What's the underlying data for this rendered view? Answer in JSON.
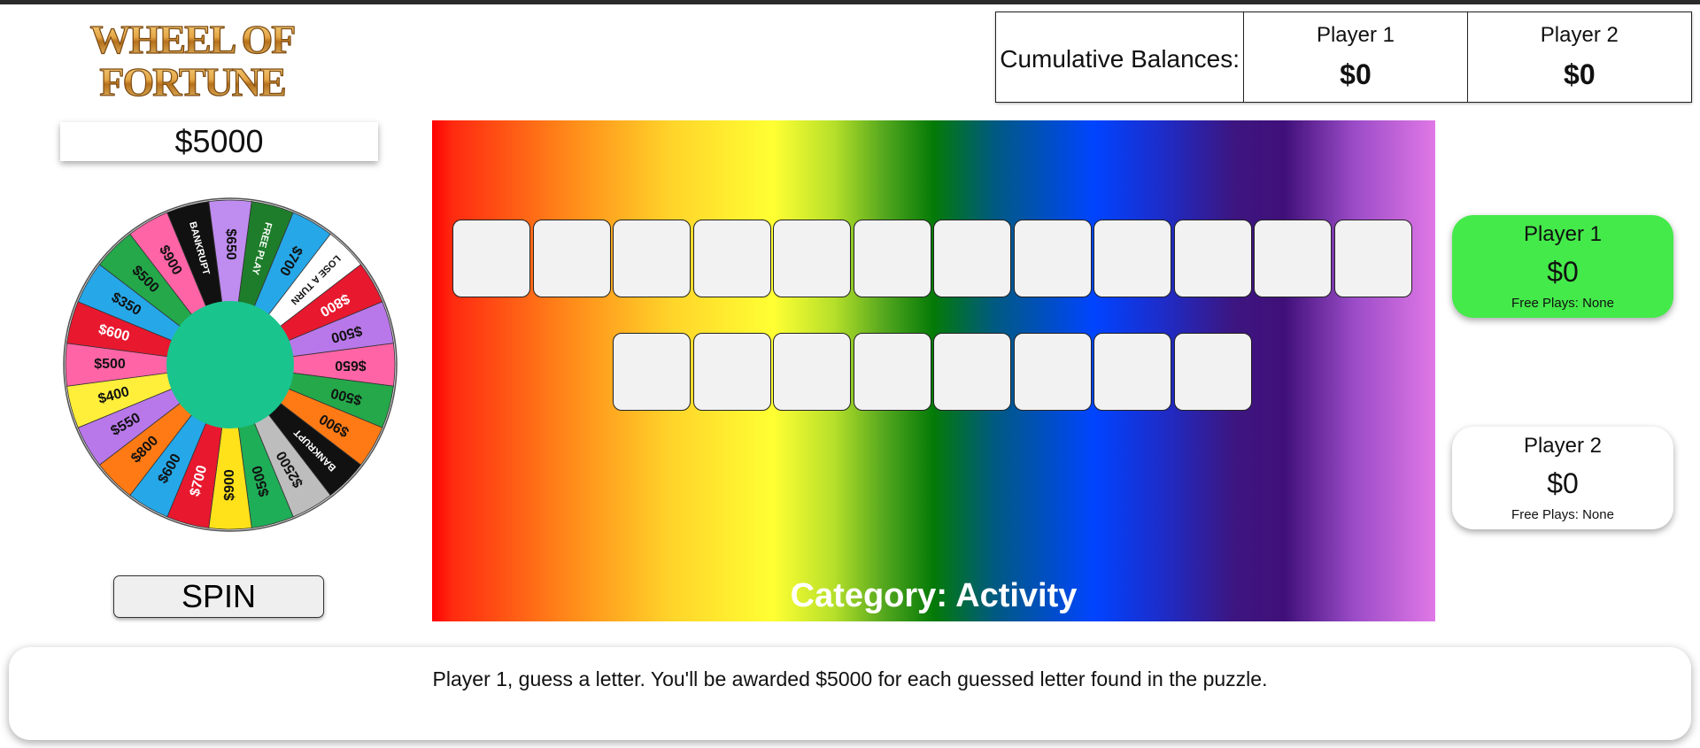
{
  "logo": {
    "line1": "WHEEL OF",
    "line2": "FORTUNE"
  },
  "spin_value": "$5000",
  "spin_button": "SPIN",
  "wheel": {
    "hub_color": "#19c48d",
    "segments": [
      {
        "label": "$650",
        "color": "#bf8cf0"
      },
      {
        "label": "FREE PLAY",
        "color": "#1e7d2a"
      },
      {
        "label": "$700",
        "color": "#26a7e8"
      },
      {
        "label": "LOSE A TURN",
        "color": "#ffffff"
      },
      {
        "label": "$800",
        "color": "#e8182f"
      },
      {
        "label": "$500",
        "color": "#b978ea"
      },
      {
        "label": "$650",
        "color": "#ff64a6"
      },
      {
        "label": "$500",
        "color": "#24a84a"
      },
      {
        "label": "$900",
        "color": "#ff7a14"
      },
      {
        "label": "BANKRUPT",
        "color": "#111111"
      },
      {
        "label": "$2500",
        "color": "#bdbdbd"
      },
      {
        "label": "$500",
        "color": "#1fae58"
      },
      {
        "label": "$900",
        "color": "#ffe21a"
      },
      {
        "label": "$700",
        "color": "#e8182f"
      },
      {
        "label": "$600",
        "color": "#26a7e8"
      },
      {
        "label": "$800",
        "color": "#ff7a14"
      },
      {
        "label": "$550",
        "color": "#b978ea"
      },
      {
        "label": "$400",
        "color": "#ffee3a"
      },
      {
        "label": "$500",
        "color": "#ff64a6"
      },
      {
        "label": "$600",
        "color": "#e8182f"
      },
      {
        "label": "$350",
        "color": "#26a7e8"
      },
      {
        "label": "$500",
        "color": "#24a84a"
      },
      {
        "label": "$900",
        "color": "#ff64a6"
      },
      {
        "label": "BANKRUPT",
        "color": "#111111"
      }
    ]
  },
  "board": {
    "row1": [
      "",
      "",
      "",
      "",
      "",
      "",
      "",
      "",
      "",
      "",
      "",
      ""
    ],
    "row2": [
      "",
      "",
      "",
      "",
      "",
      "",
      "",
      ""
    ],
    "category": "Category: Activity"
  },
  "cumulative": {
    "label": "Cumulative Balances:",
    "players": [
      {
        "name": "Player 1",
        "balance": "$0"
      },
      {
        "name": "Player 2",
        "balance": "$0"
      }
    ]
  },
  "players": [
    {
      "name": "Player 1",
      "balance": "$0",
      "free_plays": "Free Plays: None",
      "active": true
    },
    {
      "name": "Player 2",
      "balance": "$0",
      "free_plays": "Free Plays: None",
      "active": false
    }
  ],
  "message": "Player 1, guess a letter. You'll be awarded $5000 for each guessed letter found in the puzzle."
}
